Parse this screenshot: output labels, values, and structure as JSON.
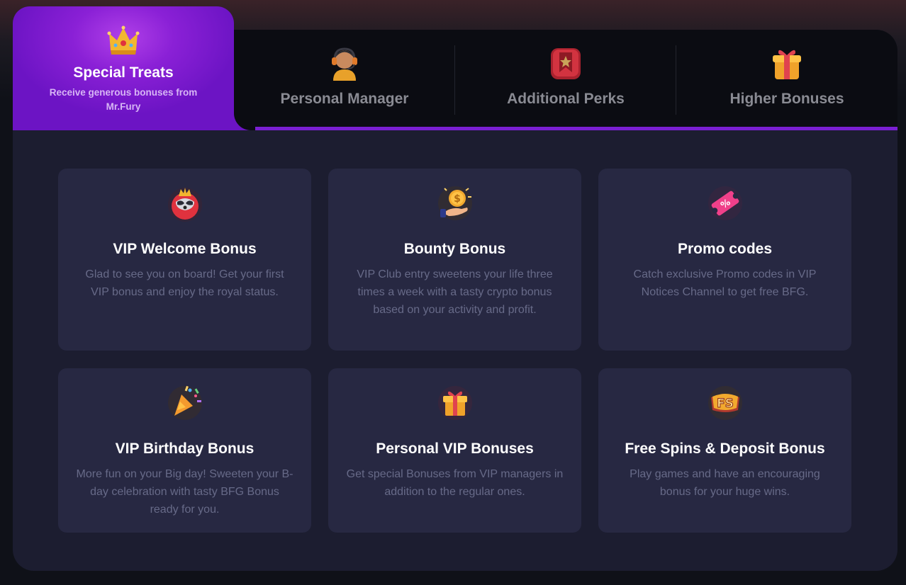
{
  "tabs": {
    "active": {
      "title": "Special Treats",
      "description": "Receive generous bonuses from Mr.Fury",
      "icon": "crown-icon"
    },
    "items": [
      {
        "label": "Personal Manager",
        "icon": "headset-manager-icon"
      },
      {
        "label": "Additional Perks",
        "icon": "bookmark-star-icon"
      },
      {
        "label": "Higher Bonuses",
        "icon": "gift-box-icon"
      }
    ]
  },
  "colors": {
    "accent": "#7a1fd2",
    "card_bg": "#272842",
    "panel_bg": "#1c1d30",
    "muted_text": "#676a88"
  },
  "cards": [
    {
      "title": "VIP Welcome Bonus",
      "text": "Glad to see you on board! Get your first VIP bonus and enjoy the royal status.",
      "icon": "raccoon-mascot-icon"
    },
    {
      "title": "Bounty Bonus",
      "text": "VIP Club entry sweetens your life three times a week with a tasty crypto bonus based on your activity and profit.",
      "icon": "coin-hand-icon"
    },
    {
      "title": "Promo codes",
      "text": "Catch exclusive Promo codes in VIP Notices Channel to get free BFG.",
      "icon": "ticket-percent-icon"
    },
    {
      "title": "VIP Birthday Bonus",
      "text": "More fun on your Big day! Sweeten your B-day celebration with tasty BFG Bonus ready for you.",
      "icon": "party-popper-icon"
    },
    {
      "title": "Personal VIP Bonuses",
      "text": "Get special Bonuses from VIP managers in addition to the regular ones.",
      "icon": "gift-icon"
    },
    {
      "title": "Free Spins & Deposit Bonus",
      "text": "Play games and have an encouraging bonus for your huge wins.",
      "icon": "free-spins-fs-icon"
    }
  ]
}
